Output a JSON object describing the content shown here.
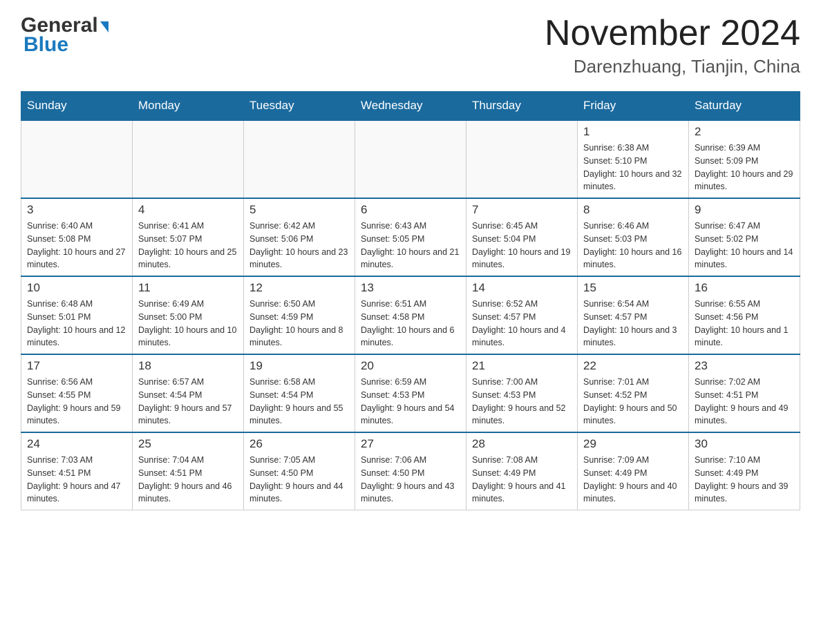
{
  "header": {
    "logo_general": "General",
    "logo_blue": "Blue",
    "month_title": "November 2024",
    "location": "Darenzhuang, Tianjin, China"
  },
  "days_of_week": [
    "Sunday",
    "Monday",
    "Tuesday",
    "Wednesday",
    "Thursday",
    "Friday",
    "Saturday"
  ],
  "weeks": [
    [
      {
        "day": "",
        "info": ""
      },
      {
        "day": "",
        "info": ""
      },
      {
        "day": "",
        "info": ""
      },
      {
        "day": "",
        "info": ""
      },
      {
        "day": "",
        "info": ""
      },
      {
        "day": "1",
        "info": "Sunrise: 6:38 AM\nSunset: 5:10 PM\nDaylight: 10 hours and 32 minutes."
      },
      {
        "day": "2",
        "info": "Sunrise: 6:39 AM\nSunset: 5:09 PM\nDaylight: 10 hours and 29 minutes."
      }
    ],
    [
      {
        "day": "3",
        "info": "Sunrise: 6:40 AM\nSunset: 5:08 PM\nDaylight: 10 hours and 27 minutes."
      },
      {
        "day": "4",
        "info": "Sunrise: 6:41 AM\nSunset: 5:07 PM\nDaylight: 10 hours and 25 minutes."
      },
      {
        "day": "5",
        "info": "Sunrise: 6:42 AM\nSunset: 5:06 PM\nDaylight: 10 hours and 23 minutes."
      },
      {
        "day": "6",
        "info": "Sunrise: 6:43 AM\nSunset: 5:05 PM\nDaylight: 10 hours and 21 minutes."
      },
      {
        "day": "7",
        "info": "Sunrise: 6:45 AM\nSunset: 5:04 PM\nDaylight: 10 hours and 19 minutes."
      },
      {
        "day": "8",
        "info": "Sunrise: 6:46 AM\nSunset: 5:03 PM\nDaylight: 10 hours and 16 minutes."
      },
      {
        "day": "9",
        "info": "Sunrise: 6:47 AM\nSunset: 5:02 PM\nDaylight: 10 hours and 14 minutes."
      }
    ],
    [
      {
        "day": "10",
        "info": "Sunrise: 6:48 AM\nSunset: 5:01 PM\nDaylight: 10 hours and 12 minutes."
      },
      {
        "day": "11",
        "info": "Sunrise: 6:49 AM\nSunset: 5:00 PM\nDaylight: 10 hours and 10 minutes."
      },
      {
        "day": "12",
        "info": "Sunrise: 6:50 AM\nSunset: 4:59 PM\nDaylight: 10 hours and 8 minutes."
      },
      {
        "day": "13",
        "info": "Sunrise: 6:51 AM\nSunset: 4:58 PM\nDaylight: 10 hours and 6 minutes."
      },
      {
        "day": "14",
        "info": "Sunrise: 6:52 AM\nSunset: 4:57 PM\nDaylight: 10 hours and 4 minutes."
      },
      {
        "day": "15",
        "info": "Sunrise: 6:54 AM\nSunset: 4:57 PM\nDaylight: 10 hours and 3 minutes."
      },
      {
        "day": "16",
        "info": "Sunrise: 6:55 AM\nSunset: 4:56 PM\nDaylight: 10 hours and 1 minute."
      }
    ],
    [
      {
        "day": "17",
        "info": "Sunrise: 6:56 AM\nSunset: 4:55 PM\nDaylight: 9 hours and 59 minutes."
      },
      {
        "day": "18",
        "info": "Sunrise: 6:57 AM\nSunset: 4:54 PM\nDaylight: 9 hours and 57 minutes."
      },
      {
        "day": "19",
        "info": "Sunrise: 6:58 AM\nSunset: 4:54 PM\nDaylight: 9 hours and 55 minutes."
      },
      {
        "day": "20",
        "info": "Sunrise: 6:59 AM\nSunset: 4:53 PM\nDaylight: 9 hours and 54 minutes."
      },
      {
        "day": "21",
        "info": "Sunrise: 7:00 AM\nSunset: 4:53 PM\nDaylight: 9 hours and 52 minutes."
      },
      {
        "day": "22",
        "info": "Sunrise: 7:01 AM\nSunset: 4:52 PM\nDaylight: 9 hours and 50 minutes."
      },
      {
        "day": "23",
        "info": "Sunrise: 7:02 AM\nSunset: 4:51 PM\nDaylight: 9 hours and 49 minutes."
      }
    ],
    [
      {
        "day": "24",
        "info": "Sunrise: 7:03 AM\nSunset: 4:51 PM\nDaylight: 9 hours and 47 minutes."
      },
      {
        "day": "25",
        "info": "Sunrise: 7:04 AM\nSunset: 4:51 PM\nDaylight: 9 hours and 46 minutes."
      },
      {
        "day": "26",
        "info": "Sunrise: 7:05 AM\nSunset: 4:50 PM\nDaylight: 9 hours and 44 minutes."
      },
      {
        "day": "27",
        "info": "Sunrise: 7:06 AM\nSunset: 4:50 PM\nDaylight: 9 hours and 43 minutes."
      },
      {
        "day": "28",
        "info": "Sunrise: 7:08 AM\nSunset: 4:49 PM\nDaylight: 9 hours and 41 minutes."
      },
      {
        "day": "29",
        "info": "Sunrise: 7:09 AM\nSunset: 4:49 PM\nDaylight: 9 hours and 40 minutes."
      },
      {
        "day": "30",
        "info": "Sunrise: 7:10 AM\nSunset: 4:49 PM\nDaylight: 9 hours and 39 minutes."
      }
    ]
  ]
}
